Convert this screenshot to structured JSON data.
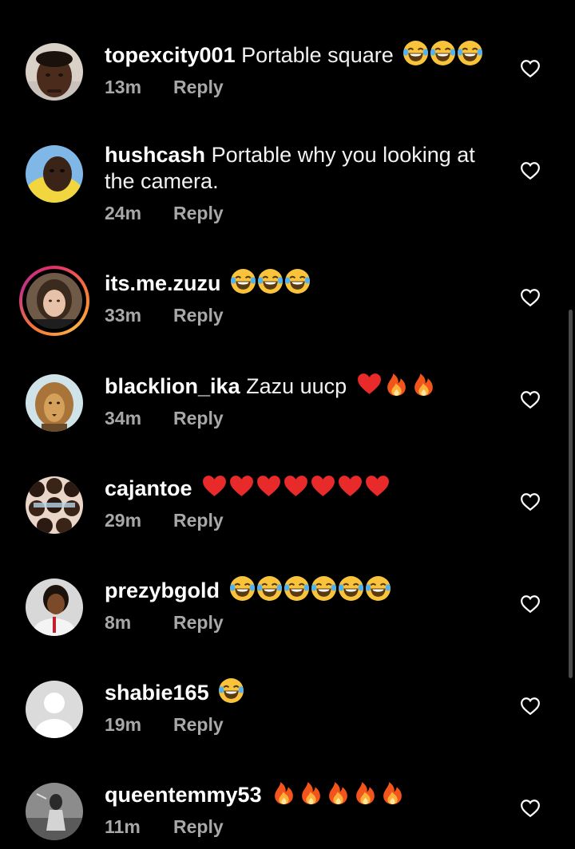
{
  "comments": [
    {
      "username": "topexcity001",
      "text": "Portable square",
      "emojis": [
        "laugh",
        "laugh",
        "laugh"
      ],
      "time": "13m",
      "reply": "Reply",
      "avatar": "man-avatar"
    },
    {
      "username": "hushcash",
      "text": "Portable why you looking at the camera.",
      "emojis": [],
      "time": "24m",
      "reply": "Reply",
      "avatar": "yellow-hood-avatar"
    },
    {
      "username": "its.me.zuzu",
      "text": "",
      "emojis": [
        "laugh",
        "laugh",
        "laugh"
      ],
      "time": "33m",
      "reply": "Reply",
      "avatar": "woman-avatar"
    },
    {
      "username": "blacklion_ika",
      "text": "Zazu uucp",
      "emojis": [
        "heart",
        "fire",
        "fire"
      ],
      "time": "34m",
      "reply": "Reply",
      "avatar": "lion-avatar"
    },
    {
      "username": "cajantoe",
      "text": "",
      "emojis": [
        "heart",
        "heart",
        "heart",
        "heart",
        "heart",
        "heart",
        "heart"
      ],
      "time": "29m",
      "reply": "Reply",
      "avatar": "hairstyles-avatar"
    },
    {
      "username": "prezybgold",
      "text": "",
      "emojis": [
        "laugh",
        "laugh",
        "laugh",
        "laugh",
        "laugh",
        "laugh"
      ],
      "time": "8m",
      "reply": "Reply",
      "avatar": "lady-avatar"
    },
    {
      "username": "shabie165",
      "text": "",
      "emojis": [
        "laugh"
      ],
      "time": "19m",
      "reply": "Reply",
      "avatar": "default-avatar"
    },
    {
      "username": "queentemmy53",
      "text": "",
      "emojis": [
        "fire",
        "fire",
        "fire",
        "fire",
        "fire"
      ],
      "time": "11m",
      "reply": "Reply",
      "avatar": "grey-photo-avatar"
    }
  ],
  "colors": {
    "background": "#000000",
    "username": "#ffffff",
    "secondary_text": "#a8a8a8",
    "story_ring": "#e1306c"
  }
}
